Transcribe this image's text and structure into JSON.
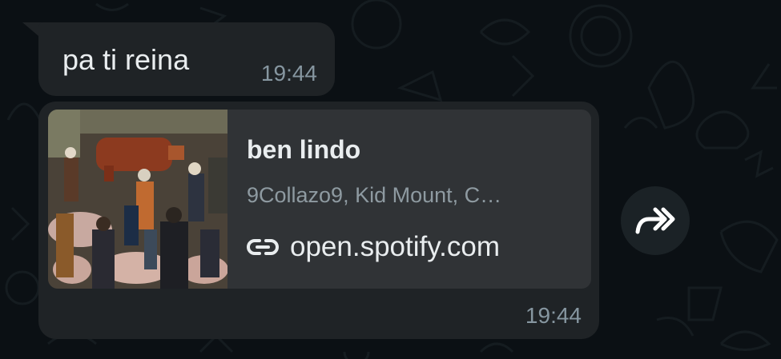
{
  "messages": [
    {
      "text": "pa ti reina",
      "time": "19:44"
    },
    {
      "time": "19:44",
      "link_preview": {
        "title": "ben lindo",
        "subtitle": "9Collazo9, Kid Mount, C…",
        "domain": "open.spotify.com",
        "icon": "link-icon",
        "thumbnail": "album-art-image"
      }
    }
  ],
  "forward_button": {
    "icon": "forward-icon"
  },
  "colors": {
    "background": "#0b1014",
    "bubble": "#1f2326",
    "preview_card": "#303336",
    "primary_text": "#e9edef",
    "secondary_text": "#8696a0"
  }
}
